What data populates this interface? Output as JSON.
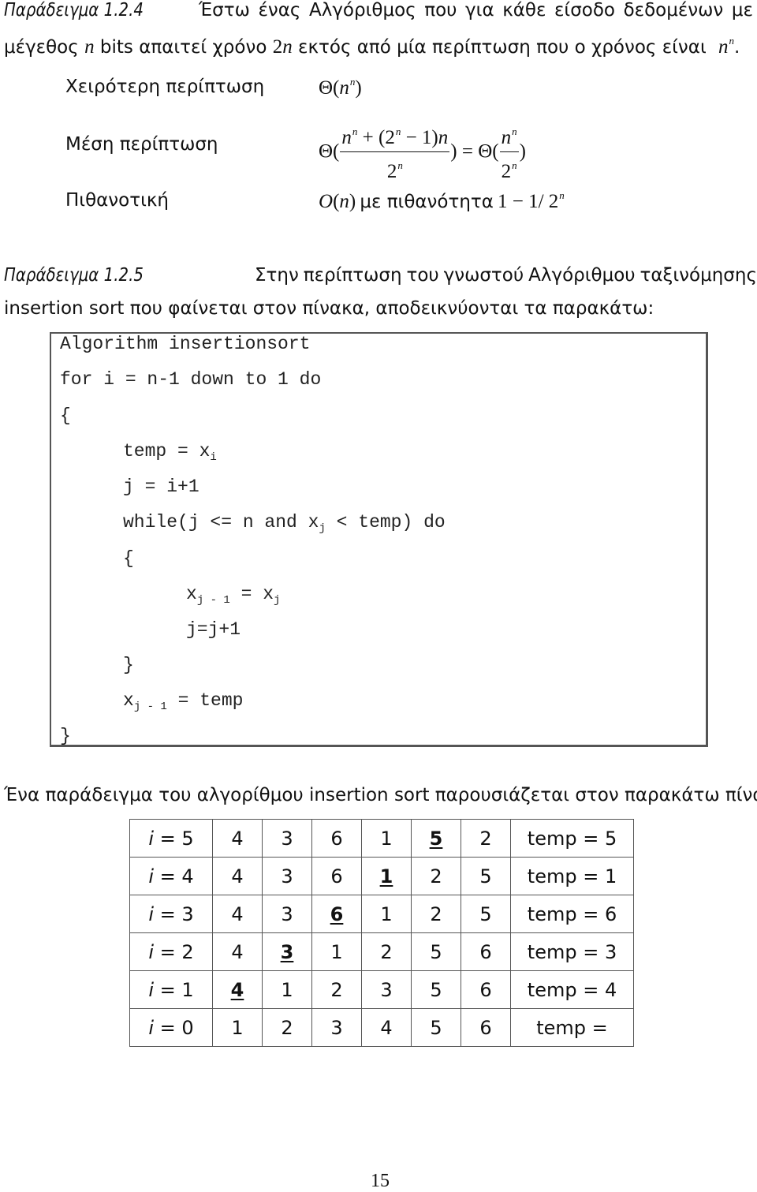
{
  "example_124": {
    "label": "Παράδειγμα 1.2.4",
    "line1_words": [
      "Έστω",
      "ένας",
      "Αλγόριθμος",
      "που",
      "για",
      "κάθε",
      "είσοδο",
      "δεδομένων",
      "με"
    ],
    "line2": {
      "part1": "μέγεθος",
      "var_n": "n",
      "part2": "bits απαιτεί χρόνο",
      "expr_2n": "2n",
      "part3": "εκτός από μία περίπτωση που ο χρόνος είναι",
      "expr_base": "n",
      "expr_sup": "n",
      "end": "."
    },
    "cases": [
      {
        "label": "Χειρότερη περίπτωση",
        "expr": "Θ(nⁿ)"
      },
      {
        "label": "Μέση περίπτωση",
        "expr": "Θ((nⁿ + (2ⁿ − 1)n) / 2ⁿ) = Θ(nⁿ / 2ⁿ)"
      },
      {
        "label": "Πιθανοτική",
        "expr": "O(n) με πιθανότητα 1 − 1/2ⁿ",
        "text_mid": "με πιθανότητα"
      }
    ]
  },
  "example_125": {
    "label": "Παράδειγμα 1.2.5",
    "line1_words": [
      "Στην",
      "περίπτωση",
      "του",
      "γνωστού",
      "Αλγόριθμου",
      "ταξινόμησης"
    ],
    "line2": "insertion sort που φαίνεται στον πίνακα, αποδεικνύονται τα παρακάτω:"
  },
  "code": {
    "title": "Algorithm insertionsort",
    "for_line": "for i = n-1 down to 1 do",
    "open_brace": "{",
    "temp_assign": "temp = x",
    "temp_sub": "i",
    "j_init": "j = i+1",
    "while_pre": "while(j <= n and x",
    "while_sub": "j",
    "while_post": " < temp) do",
    "inner_open": "{",
    "shift_x": "x",
    "shift_sub": "j - 1",
    "shift_mid": " = x",
    "shift_sub2": "j",
    "j_inc": "j=j+1",
    "inner_close": "}",
    "place_x": "x",
    "place_sub": "j - 1",
    "place_post": " = temp",
    "close_brace": "}"
  },
  "table_intro": "Ένα παράδειγμα του αλγορίθμου insertion sort παρουσιάζεται στον παρακάτω πίνακα:",
  "trace_table": {
    "rows": [
      {
        "i_var": "i",
        "i_label": " = 5",
        "values": [
          "4",
          "3",
          "6",
          "1",
          "5",
          "2"
        ],
        "highlight": 4,
        "temp": "temp = 5"
      },
      {
        "i_var": "i",
        "i_label": " = 4",
        "values": [
          "4",
          "3",
          "6",
          "1",
          "2",
          "5"
        ],
        "highlight": 3,
        "temp": "temp = 1"
      },
      {
        "i_var": "i",
        "i_label": " = 3",
        "values": [
          "4",
          "3",
          "6",
          "1",
          "2",
          "5"
        ],
        "highlight": 2,
        "temp": "temp = 6"
      },
      {
        "i_var": "i",
        "i_label": " = 2",
        "values": [
          "4",
          "3",
          "1",
          "2",
          "5",
          "6"
        ],
        "highlight": 1,
        "temp": "temp = 3"
      },
      {
        "i_var": "i",
        "i_label": " = 1",
        "values": [
          "4",
          "1",
          "2",
          "3",
          "5",
          "6"
        ],
        "highlight": 0,
        "temp": "temp = 4"
      },
      {
        "i_var": "i",
        "i_label": " = 0",
        "values": [
          "1",
          "2",
          "3",
          "4",
          "5",
          "6"
        ],
        "highlight": -1,
        "temp": "temp ="
      }
    ]
  },
  "page_number": "15"
}
